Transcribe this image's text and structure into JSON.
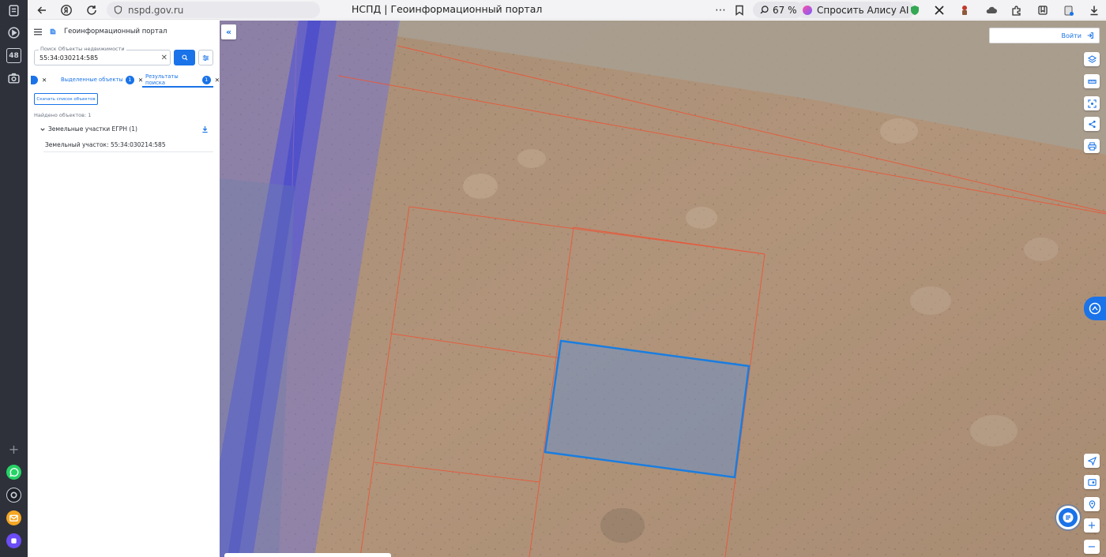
{
  "browser": {
    "url": "nspd.gov.ru",
    "tab_title": "НСПД | Геоинформационный портал",
    "zoom": "67 %",
    "alice_label": "Спросить Алису AI",
    "rail_badge": "48",
    "more_icon": "⋯"
  },
  "panel": {
    "app_title": "Геоинформационный портал",
    "search": {
      "label": "Поиск Объекты недвижимости",
      "value": "55:34:030214:585"
    },
    "tabs": [
      {
        "label": "Выделенные объекты",
        "count": "1"
      },
      {
        "label": "Результаты поиска",
        "count": "1"
      }
    ],
    "download_label": "Скачать список объектов",
    "found_text": "Найдено объектов: 1",
    "group_label": "Земельные участки ЕГРН (1)",
    "result_item": "Земельный участок: 55:34:030214:585"
  },
  "map": {
    "login_label": "Войти",
    "colors": {
      "selected_outline": "#1a7de0",
      "parcel_outline": "#e8583a",
      "zone_fill": "#6b6fe0",
      "accent": "#1a73e8"
    }
  }
}
